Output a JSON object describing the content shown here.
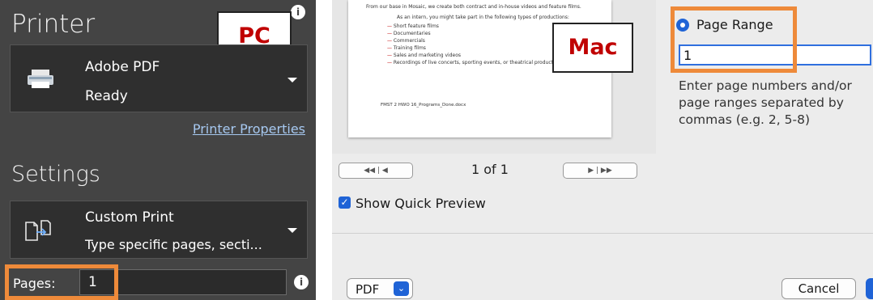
{
  "pc": {
    "tag": "PC",
    "printer_heading": "Printer",
    "info_icon": "info-icon",
    "printer": {
      "name": "Adobe PDF",
      "status": "Ready",
      "icon": "printer-icon"
    },
    "printer_properties_link": "Printer Properties",
    "settings_heading": "Settings",
    "print_option": {
      "name": "Custom Print",
      "description": "Type specific pages, secti...",
      "icon": "custom-print-icon"
    },
    "pages": {
      "label": "Pages:",
      "value": "1"
    },
    "highlight_color": "#ee8a3a"
  },
  "mac": {
    "tag": "Mac",
    "preview_doc": {
      "header_line": "From our base in Mosaic, we create both contract and in-house videos and feature films.",
      "intro_line": "As an intern, you might take part in the following types of productions:",
      "bullets": [
        "Short feature films",
        "Documentaries",
        "Commercials",
        "Training films",
        "Sales and marketing videos",
        "Recordings of live concerts, sporting events, or theatrical productions"
      ],
      "footer_line": "FMST 2 HWO 16_Programs_Done.docx"
    },
    "nav_prev_glyphs": "◀◀  |  ◀",
    "nav_next_glyphs": "▶  |  ▶▶",
    "page_count": "1 of 1",
    "quick_preview_label": "Show Quick Preview",
    "quick_preview_checked": true,
    "page_range_label": "Page Range",
    "page_range_value": "1",
    "page_range_help": "Enter page numbers and/or page ranges separated by commas (e.g. 2, 5-8)",
    "pdf_button_label": "PDF",
    "cancel_button_label": "Cancel",
    "accent_color": "#1f63d6"
  }
}
